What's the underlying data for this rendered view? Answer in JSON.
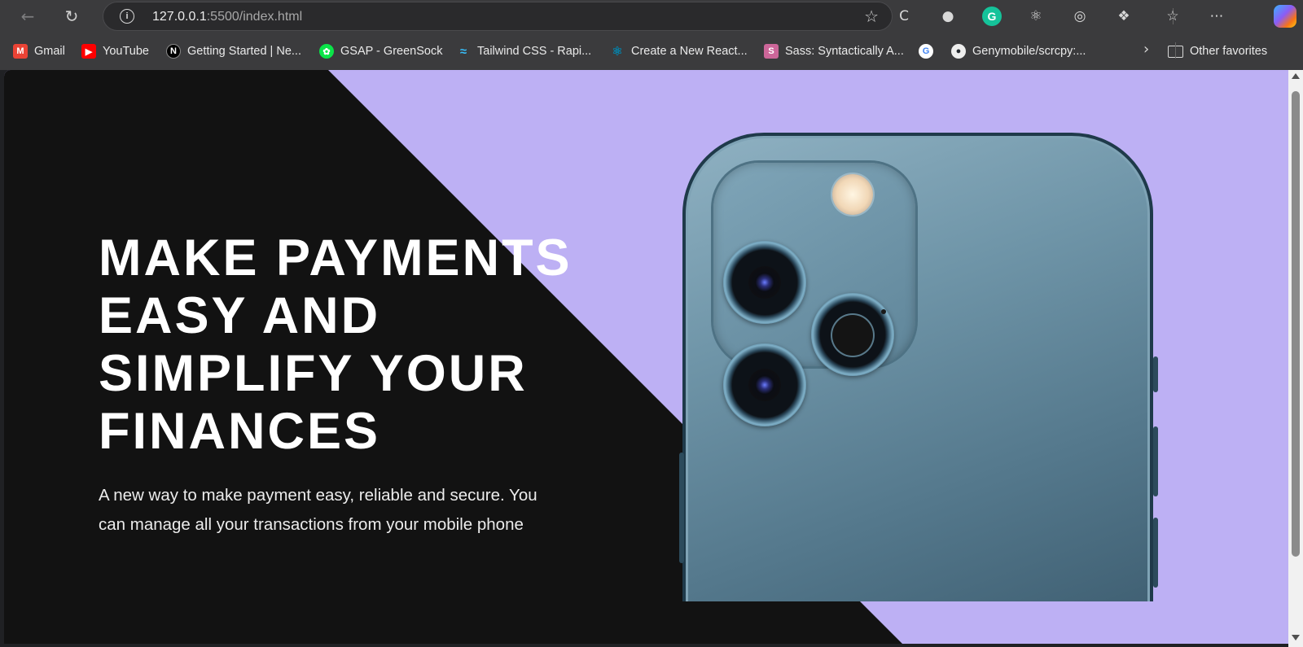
{
  "browser": {
    "url_host": "127.0.0.1",
    "url_rest": ":5500/index.html",
    "bookmarks": [
      {
        "label": "Gmail",
        "icon": "gmail-icon",
        "color": "#ea4335"
      },
      {
        "label": "YouTube",
        "icon": "youtube-icon",
        "color": "#ff0000"
      },
      {
        "label": "Getting Started | Ne...",
        "icon": "nextjs-icon",
        "color": "#000000"
      },
      {
        "label": "GSAP - GreenSock",
        "icon": "gsap-icon",
        "color": "#0ae448"
      },
      {
        "label": "Tailwind CSS - Rapi...",
        "icon": "tailwind-icon",
        "color": "#38bdf8"
      },
      {
        "label": "Create a New React...",
        "icon": "react-icon",
        "color": "#087ea4"
      },
      {
        "label": "Sass: Syntactically A...",
        "icon": "sass-icon",
        "color": "#cc6699"
      },
      {
        "label": "",
        "icon": "google-icon",
        "color": "#4285f4"
      },
      {
        "label": "Genymobile/scrcpy:...",
        "icon": "github-icon",
        "color": "#24292f"
      }
    ],
    "other_favorites": "Other favorites"
  },
  "hero": {
    "title_lines": [
      "MAKE PAYMENTS",
      "EASY AND",
      "SIMPLIFY YOUR",
      "FINANCES"
    ],
    "subtitle_lines": [
      "A new way to make payment easy, reliable and secure. You",
      "can manage all your transactions from your mobile phone"
    ]
  },
  "colors": {
    "background_lavender": "#bdb0f4",
    "diagonal_black": "#121212",
    "heading_white": "#ffffff"
  }
}
